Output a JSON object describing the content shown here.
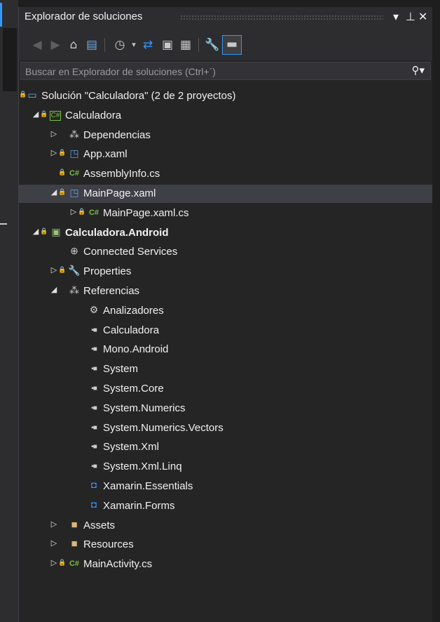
{
  "panel": {
    "title": "Explorador de soluciones",
    "title_buttons": {
      "dropdown": "▾",
      "pin": "⊥",
      "close": "✕"
    }
  },
  "toolbar": {
    "tools": [
      "back",
      "forward",
      "home",
      "switch-views",
      "pending-changes-filter",
      "sync-with-active-document",
      "collapse-all",
      "show-all-files",
      "properties",
      "preview-selected-items"
    ]
  },
  "search": {
    "placeholder": "Buscar en Explorador de soluciones (Ctrl+´)"
  },
  "tree": {
    "items": [
      {
        "label": "Solución \"Calculadora\" (2 de 2 proyectos)",
        "icon": "solution-icon",
        "locked": true,
        "expander": "",
        "bold": false
      },
      {
        "label": "Calculadora",
        "icon": "csharp-project-icon",
        "locked": true,
        "expander": "expanded",
        "bold": false
      },
      {
        "label": "Dependencias",
        "icon": "dependencies-icon",
        "locked": false,
        "expander": "collapsed",
        "bold": false
      },
      {
        "label": "App.xaml",
        "icon": "xaml-icon",
        "locked": true,
        "expander": "collapsed",
        "bold": false
      },
      {
        "label": "AssemblyInfo.cs",
        "icon": "csharp-file-icon",
        "locked": true,
        "expander": "",
        "bold": false
      },
      {
        "label": "MainPage.xaml",
        "icon": "xaml-icon",
        "locked": true,
        "expander": "expanded",
        "bold": false,
        "selected": true
      },
      {
        "label": "MainPage.xaml.cs",
        "icon": "csharp-file-icon",
        "locked": true,
        "expander": "collapsed",
        "bold": false
      },
      {
        "label": "Calculadora.Android",
        "icon": "android-project-icon",
        "locked": true,
        "expander": "expanded",
        "bold": true
      },
      {
        "label": "Connected Services",
        "icon": "connected-services-icon",
        "locked": false,
        "expander": "",
        "bold": false
      },
      {
        "label": "Properties",
        "icon": "wrench-icon",
        "locked": true,
        "expander": "collapsed",
        "bold": false
      },
      {
        "label": "Referencias",
        "icon": "references-icon",
        "locked": false,
        "expander": "expanded",
        "bold": false
      },
      {
        "label": "Analizadores",
        "icon": "analyzer-icon",
        "locked": false,
        "expander": "",
        "bold": false
      },
      {
        "label": "Calculadora",
        "icon": "reference-icon",
        "locked": false,
        "expander": "",
        "bold": false
      },
      {
        "label": "Mono.Android",
        "icon": "reference-icon",
        "locked": false,
        "expander": "",
        "bold": false
      },
      {
        "label": "System",
        "icon": "reference-icon",
        "locked": false,
        "expander": "",
        "bold": false
      },
      {
        "label": "System.Core",
        "icon": "reference-icon",
        "locked": false,
        "expander": "",
        "bold": false
      },
      {
        "label": "System.Numerics",
        "icon": "reference-icon",
        "locked": false,
        "expander": "",
        "bold": false
      },
      {
        "label": "System.Numerics.Vectors",
        "icon": "reference-icon",
        "locked": false,
        "expander": "",
        "bold": false
      },
      {
        "label": "System.Xml",
        "icon": "reference-icon",
        "locked": false,
        "expander": "",
        "bold": false
      },
      {
        "label": "System.Xml.Linq",
        "icon": "reference-icon",
        "locked": false,
        "expander": "",
        "bold": false
      },
      {
        "label": "Xamarin.Essentials",
        "icon": "nuget-package-icon",
        "locked": false,
        "expander": "",
        "bold": false
      },
      {
        "label": "Xamarin.Forms",
        "icon": "nuget-package-icon",
        "locked": false,
        "expander": "",
        "bold": false
      },
      {
        "label": "Assets",
        "icon": "folder-icon",
        "locked": false,
        "expander": "collapsed",
        "bold": false
      },
      {
        "label": "Resources",
        "icon": "folder-icon",
        "locked": false,
        "expander": "collapsed",
        "bold": false
      },
      {
        "label": "MainActivity.cs",
        "icon": "csharp-file-icon",
        "locked": true,
        "expander": "collapsed",
        "bold": false
      }
    ]
  }
}
